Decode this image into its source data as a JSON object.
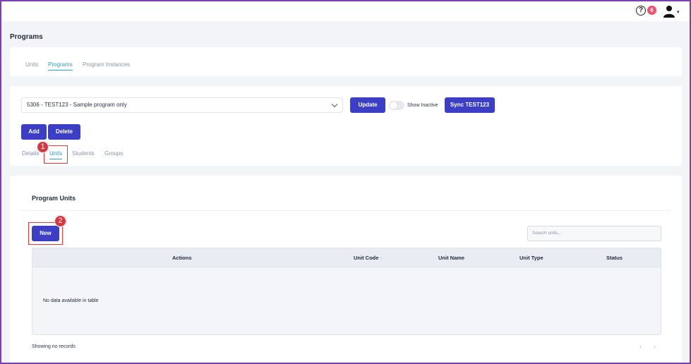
{
  "header": {
    "help_icon": "?",
    "notification_count": "6",
    "user_caret": "▾"
  },
  "page": {
    "title": "Programs"
  },
  "tabs": [
    {
      "label": "Units",
      "active": false
    },
    {
      "label": "Programs",
      "active": true
    },
    {
      "label": "Program Instances",
      "active": false
    }
  ],
  "program": {
    "selected": "5306 - TEST123 - Sample program only",
    "update_label": "Update",
    "show_inactive_label": "Show Inactive",
    "sync_label": "Sync TEST123",
    "add_label": "Add",
    "delete_label": "Delete"
  },
  "subtabs": [
    {
      "label": "Details",
      "active": false
    },
    {
      "label": "Units",
      "active": true
    },
    {
      "label": "Students",
      "active": false
    },
    {
      "label": "Groups",
      "active": false
    }
  ],
  "program_units": {
    "title": "Program Units",
    "new_label": "New",
    "search_placeholder": "Search units...",
    "columns": [
      "Actions",
      "Unit Code",
      "Unit Name",
      "Unit Type",
      "Status"
    ],
    "sort_indicator": "↑",
    "empty_text": "No data available in table",
    "footer_text": "Showing no records",
    "prev_icon": "‹",
    "next_icon": "›"
  },
  "callouts": [
    "1",
    "2"
  ],
  "colors": {
    "primary_button": "#3c3fc6",
    "active_tab": "#2b9fd9",
    "callout_red": "#d9363e",
    "badge": "#f0506e",
    "frame": "#7b3fb3"
  }
}
